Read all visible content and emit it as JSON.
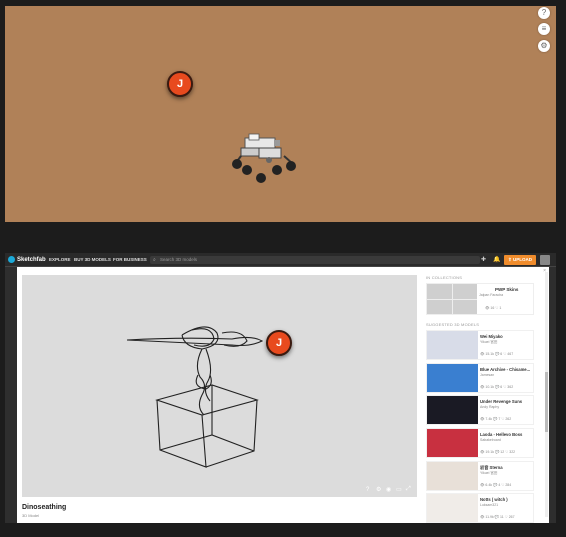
{
  "top_viewer": {
    "buttons": [
      {
        "name": "help-icon",
        "glyph": "?"
      },
      {
        "name": "layers-icon",
        "glyph": "≡"
      },
      {
        "name": "settings-icon",
        "glyph": "⚙"
      }
    ],
    "pin_label": "J"
  },
  "nav": {
    "logo": "Sketchfab",
    "links": [
      "EXPLORE",
      "BUY 3D MODELS",
      "FOR BUSINESS"
    ],
    "search_placeholder": "Search 3D models",
    "upload_label": "⇪ UPLOAD"
  },
  "model": {
    "pin_label": "J",
    "title": "Dinoseathing",
    "subtitle": "3D Model",
    "controls": [
      "?",
      "⚙",
      "◉",
      "▭",
      "⤢"
    ]
  },
  "sidebar": {
    "collections_head": "IN COLLECTIONS",
    "collection": {
      "name": "PWP Skins",
      "by": "Jalpan Faracha",
      "stats": "👁 16   ♡ 1"
    },
    "suggested_head": "SUGGESTED 3D MODELS",
    "suggested": [
      {
        "title": "Wei Miyako",
        "author": "Yikuei 宮田",
        "stats": "👁 15.1k  💬 6  ♡ 467",
        "color": "#d8dce8"
      },
      {
        "title": "Blue Archive - Chisame...",
        "author": "Jamesan",
        "stats": "👁 10.1k  💬 6  ♡ 362",
        "color": "#3a7fd0"
      },
      {
        "title": "Under Revenge Suns",
        "author": "Andy Raphy",
        "stats": "👁 7.4k  💬 7  ♡ 262",
        "color": "#1a1a24"
      },
      {
        "title": "Laoda - Hellevo Boss",
        "author": "Sabakelroard",
        "stats": "👁 19.1k  💬 12  ♡ 322",
        "color": "#c83040"
      },
      {
        "title": "初音 Sterna",
        "author": "Yikuei 宮田",
        "stats": "👁 6.4k  💬 4  ♡ 284",
        "color": "#e8e0d8"
      },
      {
        "title": "Notts ( witch )",
        "author": "Luksam321",
        "stats": "👁 11.9k  💬 11  ♡ 267",
        "color": "#f0ece8"
      }
    ]
  }
}
